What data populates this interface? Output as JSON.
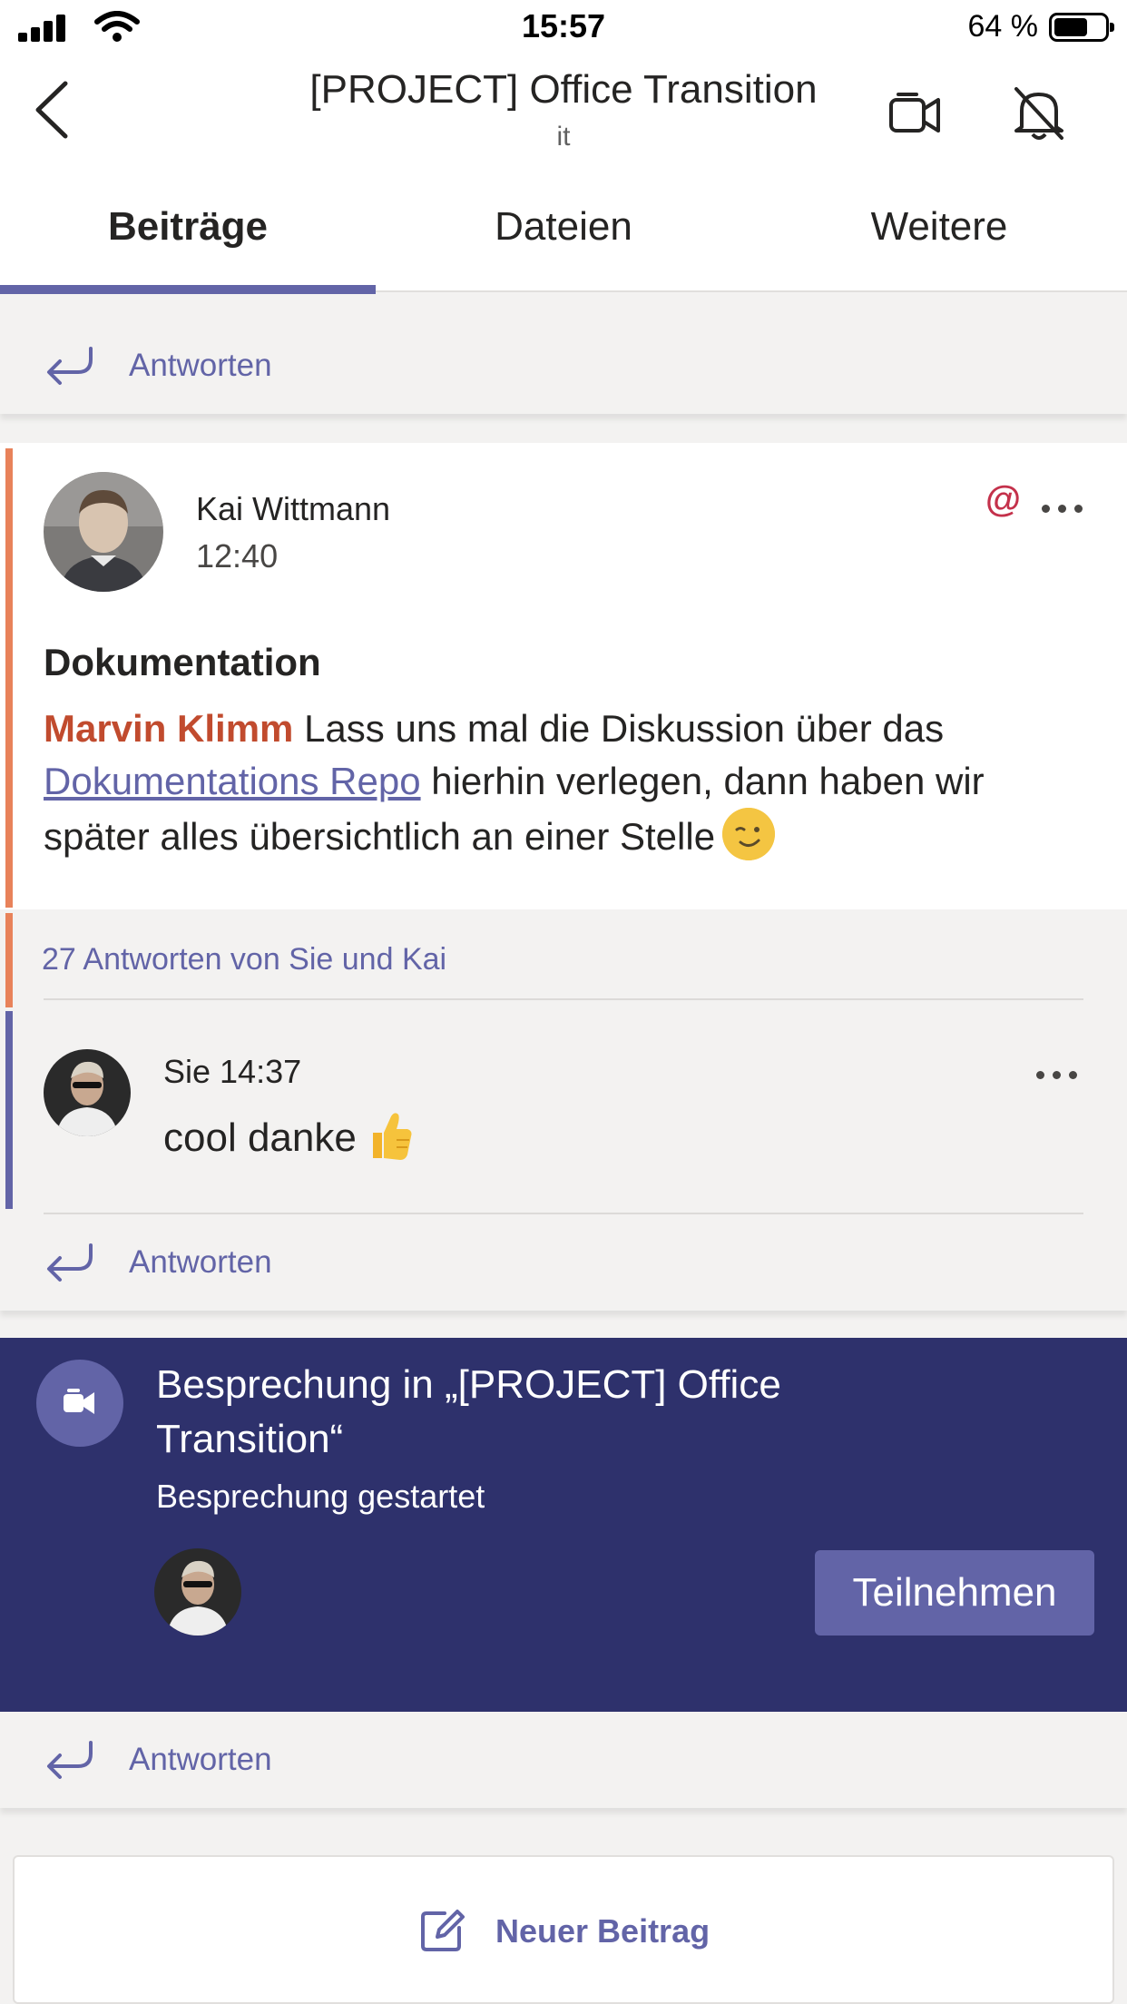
{
  "status_bar": {
    "time": "15:57",
    "battery": "64 %"
  },
  "header": {
    "title": "[PROJECT] Office Transition",
    "subtitle": "it"
  },
  "tabs": [
    {
      "label": "Beiträge",
      "active": true
    },
    {
      "label": "Dateien",
      "active": false
    },
    {
      "label": "Weitere",
      "active": false
    }
  ],
  "reply_label": "Antworten",
  "post": {
    "author": "Kai Wittmann",
    "time": "12:40",
    "mention_icon": "@",
    "subject": "Dokumentation",
    "mention": "Marvin Klimm",
    "body_1": " Lass uns mal die Diskussion über das ",
    "link": "Dokumentations Repo",
    "body_2": " hierhin verlegen, dann haben wir später alles übersichtlich an einer Stelle"
  },
  "thread": {
    "replies_summary": "27 Antworten von Sie und Kai",
    "reply": {
      "meta": "Sie 14:37",
      "text": "cool danke"
    }
  },
  "meeting": {
    "title": "Besprechung in „[PROJECT] Office Transition“",
    "status": "Besprechung gestartet",
    "join_label": "Teilnehmen"
  },
  "new_post_label": "Neuer Beitrag",
  "colors": {
    "accent": "#6264a7",
    "meeting_bg": "#2e316c",
    "mention": "#c14b2e",
    "thread_accent": "#e8825a"
  }
}
